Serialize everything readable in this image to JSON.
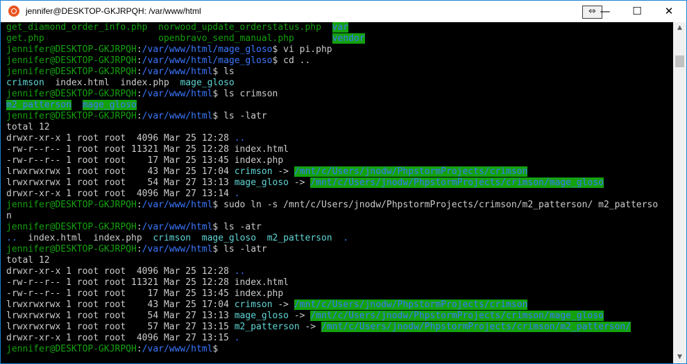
{
  "window": {
    "title": "jennifer@DESKTOP-GKJRPQH: /var/www/html",
    "icon": "ubuntu-icon",
    "resize_glyph": "⇔",
    "minimize_glyph": "—",
    "maximize_glyph": "☐",
    "close_glyph": "✕"
  },
  "scrollbar": {
    "up_glyph": "▲",
    "down_glyph": "▼"
  },
  "colors": {
    "prompt_green": "#13a10e",
    "path_blue": "#3b78ff",
    "dir_cyan": "#3a96dd",
    "link_cyan": "#61d6d6",
    "text": "#cccccc",
    "highlight_green": "#13a10e"
  },
  "terminal": {
    "lines": [
      [
        {
          "t": "get_diamond_order_info.php  norwood_update_orderstatus.php  ",
          "c": "g"
        },
        {
          "t": "var",
          "c": "b bg"
        }
      ],
      [
        {
          "t": "get.php                     openbravo_send_manual.php       ",
          "c": "g"
        },
        {
          "t": "vendor",
          "c": "b bg"
        }
      ],
      [
        {
          "t": "jennifer@DESKTOP-GKJRPQH",
          "c": "g"
        },
        {
          "t": ":",
          "c": "w"
        },
        {
          "t": "/var/www/html/mage_gloso",
          "c": "b"
        },
        {
          "t": "$ vi pi.php",
          "c": "w"
        }
      ],
      [
        {
          "t": "jennifer@DESKTOP-GKJRPQH",
          "c": "g"
        },
        {
          "t": ":",
          "c": "w"
        },
        {
          "t": "/var/www/html/mage_gloso",
          "c": "b"
        },
        {
          "t": "$ cd ..",
          "c": "w"
        }
      ],
      [
        {
          "t": "jennifer@DESKTOP-GKJRPQH",
          "c": "g"
        },
        {
          "t": ":",
          "c": "w"
        },
        {
          "t": "/var/www/html",
          "c": "b"
        },
        {
          "t": "$ ls",
          "c": "w"
        }
      ],
      [
        {
          "t": "crimson",
          "c": "bc"
        },
        {
          "t": "  index.html  index.php  ",
          "c": "w"
        },
        {
          "t": "mage_gloso",
          "c": "bc"
        }
      ],
      [
        {
          "t": "jennifer@DESKTOP-GKJRPQH",
          "c": "g"
        },
        {
          "t": ":",
          "c": "w"
        },
        {
          "t": "/var/www/html",
          "c": "b"
        },
        {
          "t": "$ ls crimson",
          "c": "w"
        }
      ],
      [
        {
          "t": "m2_patterson",
          "c": "b bg"
        },
        {
          "t": "  ",
          "c": "w"
        },
        {
          "t": "mage_gloso",
          "c": "b bg"
        }
      ],
      [
        {
          "t": "jennifer@DESKTOP-GKJRPQH",
          "c": "g"
        },
        {
          "t": ":",
          "c": "w"
        },
        {
          "t": "/var/www/html",
          "c": "b"
        },
        {
          "t": "$ ls -latr",
          "c": "w"
        }
      ],
      [
        {
          "t": "total 12",
          "c": "w"
        }
      ],
      [
        {
          "t": "drwxr-xr-x 1 root root  4096 Mar 25 12:28 ",
          "c": "w"
        },
        {
          "t": "..",
          "c": "b"
        }
      ],
      [
        {
          "t": "-rw-r--r-- 1 root root 11321 Mar 25 12:28 index.html",
          "c": "w"
        }
      ],
      [
        {
          "t": "-rw-r--r-- 1 root root    17 Mar 25 13:45 index.php",
          "c": "w"
        }
      ],
      [
        {
          "t": "lrwxrwxrwx 1 root root    43 Mar 25 17:04 ",
          "c": "w"
        },
        {
          "t": "crimson",
          "c": "bc"
        },
        {
          "t": " -> ",
          "c": "w"
        },
        {
          "t": "/mnt/c/Users/jnodw/PhpstormProjects/crimson",
          "c": "b bg"
        }
      ],
      [
        {
          "t": "lrwxrwxrwx 1 root root    54 Mar 27 13:13 ",
          "c": "w"
        },
        {
          "t": "mage_gloso",
          "c": "bc"
        },
        {
          "t": " -> ",
          "c": "w"
        },
        {
          "t": "/mnt/c/Users/jnodw/PhpstormProjects/crimson/mage_gloso",
          "c": "b bg"
        }
      ],
      [
        {
          "t": "drwxr-xr-x 1 root root  4096 Mar 27 13:14 ",
          "c": "w"
        },
        {
          "t": ".",
          "c": "b"
        }
      ],
      [
        {
          "t": "jennifer@DESKTOP-GKJRPQH",
          "c": "g"
        },
        {
          "t": ":",
          "c": "w"
        },
        {
          "t": "/var/www/html",
          "c": "b"
        },
        {
          "t": "$ sudo ln -s /mnt/c/Users/jnodw/PhpstormProjects/crimson/m2_patterson/ m2_patterso",
          "c": "w"
        }
      ],
      [
        {
          "t": "n",
          "c": "w"
        }
      ],
      [
        {
          "t": "jennifer@DESKTOP-GKJRPQH",
          "c": "g"
        },
        {
          "t": ":",
          "c": "w"
        },
        {
          "t": "/var/www/html",
          "c": "b"
        },
        {
          "t": "$ ls -atr",
          "c": "w"
        }
      ],
      [
        {
          "t": "..",
          "c": "b"
        },
        {
          "t": "  index.html  index.php  ",
          "c": "w"
        },
        {
          "t": "crimson",
          "c": "bc"
        },
        {
          "t": "  ",
          "c": "w"
        },
        {
          "t": "mage_gloso",
          "c": "bc"
        },
        {
          "t": "  ",
          "c": "w"
        },
        {
          "t": "m2_patterson",
          "c": "bc"
        },
        {
          "t": "  ",
          "c": "w"
        },
        {
          "t": ".",
          "c": "b"
        }
      ],
      [
        {
          "t": "jennifer@DESKTOP-GKJRPQH",
          "c": "g"
        },
        {
          "t": ":",
          "c": "w"
        },
        {
          "t": "/var/www/html",
          "c": "b"
        },
        {
          "t": "$ ls -latr",
          "c": "w"
        }
      ],
      [
        {
          "t": "total 12",
          "c": "w"
        }
      ],
      [
        {
          "t": "drwxr-xr-x 1 root root  4096 Mar 25 12:28 ",
          "c": "w"
        },
        {
          "t": "..",
          "c": "b"
        }
      ],
      [
        {
          "t": "-rw-r--r-- 1 root root 11321 Mar 25 12:28 index.html",
          "c": "w"
        }
      ],
      [
        {
          "t": "-rw-r--r-- 1 root root    17 Mar 25 13:45 index.php",
          "c": "w"
        }
      ],
      [
        {
          "t": "lrwxrwxrwx 1 root root    43 Mar 25 17:04 ",
          "c": "w"
        },
        {
          "t": "crimson",
          "c": "bc"
        },
        {
          "t": " -> ",
          "c": "w"
        },
        {
          "t": "/mnt/c/Users/jnodw/PhpstormProjects/crimson",
          "c": "b bg"
        }
      ],
      [
        {
          "t": "lrwxrwxrwx 1 root root    54 Mar 27 13:13 ",
          "c": "w"
        },
        {
          "t": "mage_gloso",
          "c": "bc"
        },
        {
          "t": " -> ",
          "c": "w"
        },
        {
          "t": "/mnt/c/Users/jnodw/PhpstormProjects/crimson/mage_gloso",
          "c": "b bg"
        }
      ],
      [
        {
          "t": "lrwxrwxrwx 1 root root    57 Mar 27 13:15 ",
          "c": "w"
        },
        {
          "t": "m2_patterson",
          "c": "bc"
        },
        {
          "t": " -> ",
          "c": "w"
        },
        {
          "t": "/mnt/c/Users/jnodw/PhpstormProjects/crimson/m2_patterson/",
          "c": "b bg"
        }
      ],
      [
        {
          "t": "drwxr-xr-x 1 root root  4096 Mar 27 13:15 ",
          "c": "w"
        },
        {
          "t": ".",
          "c": "b"
        }
      ],
      [
        {
          "t": "jennifer@DESKTOP-GKJRPQH",
          "c": "g"
        },
        {
          "t": ":",
          "c": "w"
        },
        {
          "t": "/var/www/html",
          "c": "b"
        },
        {
          "t": "$",
          "c": "w"
        }
      ]
    ]
  }
}
